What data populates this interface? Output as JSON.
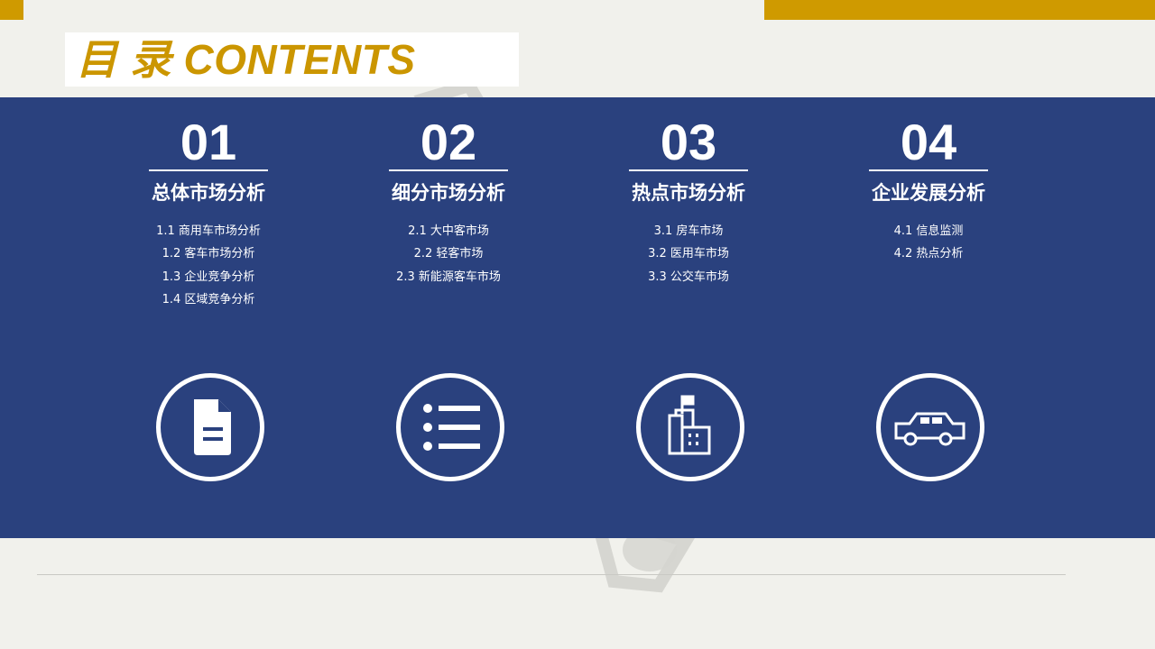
{
  "header": {
    "title": "目 录 CONTENTS",
    "accent_color": "#cf9a00",
    "band_color": "#2a417e"
  },
  "sections": [
    {
      "number": "01",
      "title": "总体市场分析",
      "items": [
        "1.1 商用车市场分析",
        "1.2 客车市场分析",
        "1.3 企业竞争分析",
        "1.4 区域竞争分析"
      ],
      "icon": "document-icon"
    },
    {
      "number": "02",
      "title": "细分市场分析",
      "items": [
        "2.1 大中客市场",
        "2.2 轻客市场",
        "2.3 新能源客车市场"
      ],
      "icon": "list-icon"
    },
    {
      "number": "03",
      "title": "热点市场分析",
      "items": [
        "3.1 房车市场",
        "3.2 医用车市场",
        "3.3 公交车市场"
      ],
      "icon": "building-flag-icon"
    },
    {
      "number": "04",
      "title": "企业发展分析",
      "items": [
        "4.1 信息监测",
        "4.2 热点分析"
      ],
      "icon": "car-icon"
    }
  ]
}
